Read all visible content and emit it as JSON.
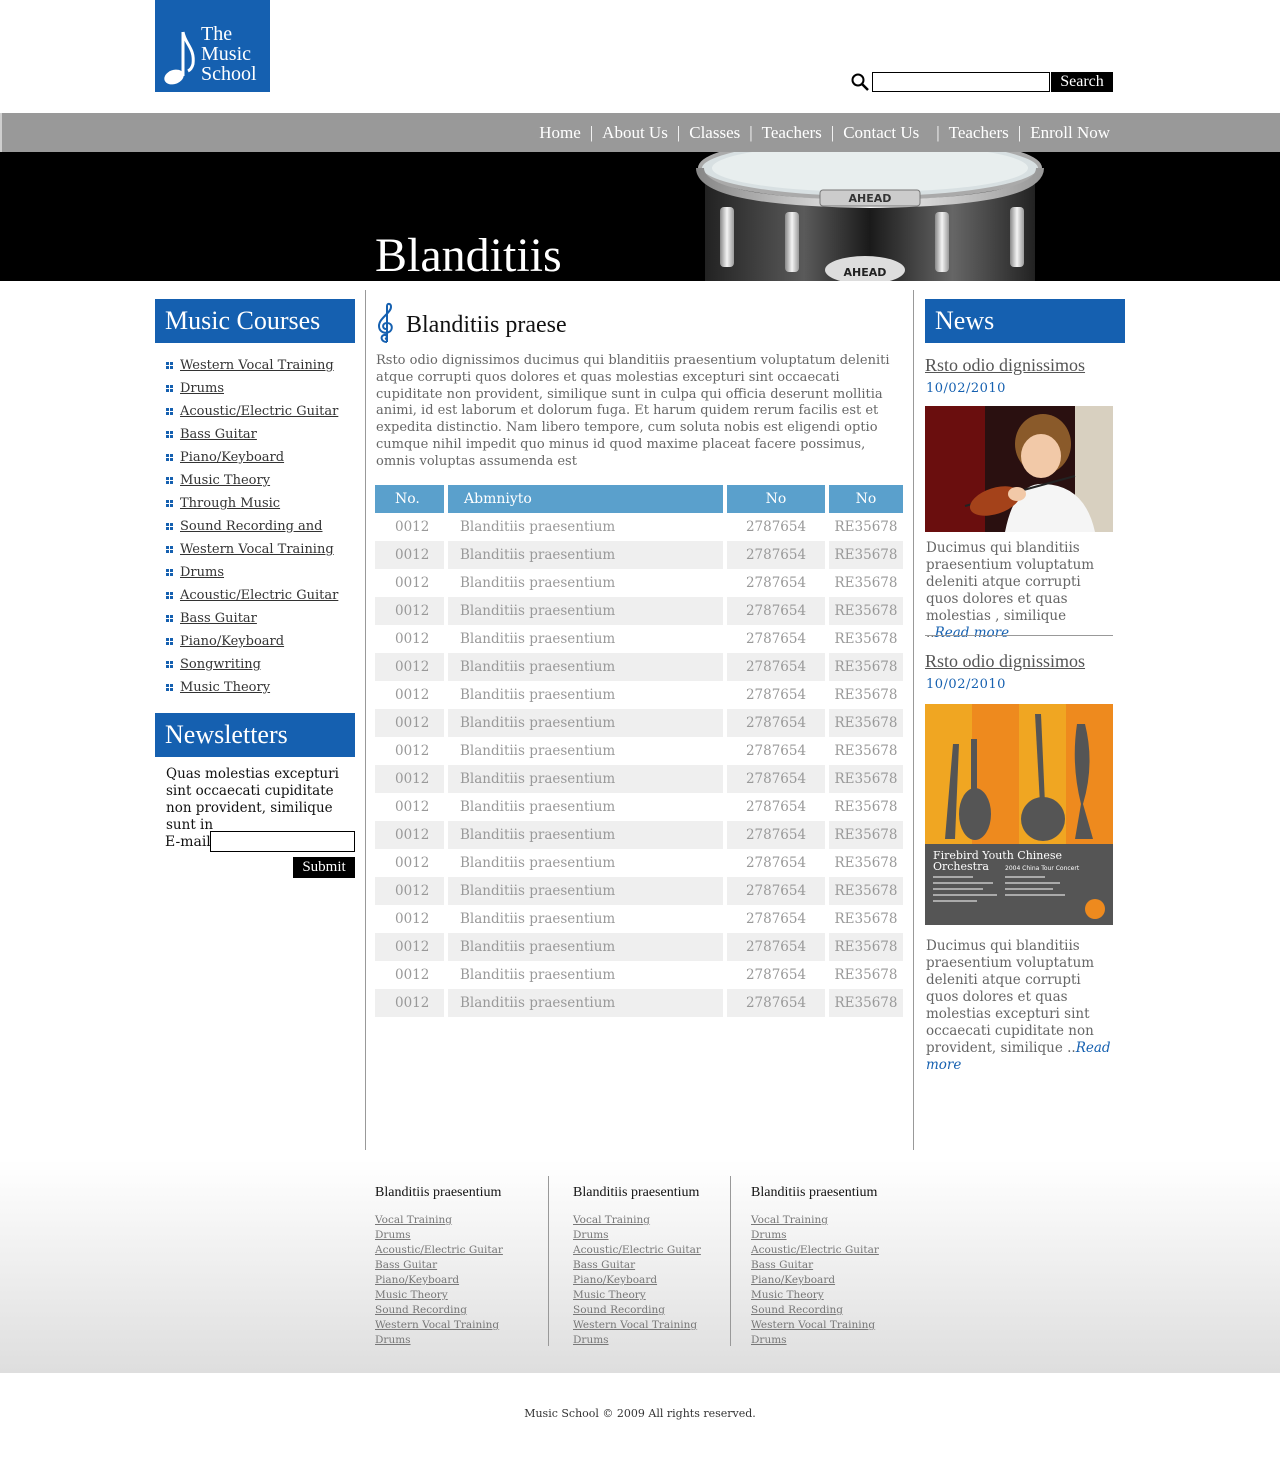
{
  "logo": {
    "line1": "The",
    "line2": "Music",
    "line3": "School"
  },
  "search": {
    "button_label": "Search",
    "value": ""
  },
  "nav": {
    "items": [
      "Home",
      "About Us",
      "Classes",
      "Teachers",
      "Contact Us",
      "Teachers",
      "Enroll Now"
    ]
  },
  "banner": {
    "title": "Blanditiis"
  },
  "sidebar": {
    "courses_title": "Music Courses",
    "courses": [
      "Western Vocal Training",
      "Drums",
      "Acoustic/Electric Guitar",
      "Bass Guitar",
      "Piano/Keyboard",
      "Music Theory",
      "Through Music",
      "Sound Recording and",
      "Western Vocal Training",
      "Drums",
      "Acoustic/Electric Guitar",
      "Bass Guitar",
      "Piano/Keyboard",
      "Songwriting",
      "Music Theory"
    ],
    "newsletter_title": "Newsletters",
    "newsletter_text": "Quas molestias excepturi sint occaecati cupiditate non provident, similique sunt in",
    "email_label": "E-mail",
    "submit_label": "Submit"
  },
  "main": {
    "title": "Blanditiis praese",
    "paragraph": "Rsto odio dignissimos ducimus qui blanditiis praesentium voluptatum deleniti atque corrupti quos dolores et quas molestias excepturi sint occaecati cupiditate non provident, similique sunt in culpa qui officia deserunt mollitia animi, id est laborum et dolorum fuga. Et harum quidem rerum facilis est et expedita distinctio. Nam libero tempore, cum soluta nobis est eligendi optio cumque nihil impedit quo minus id quod maxime placeat facere possimus, omnis voluptas assumenda est",
    "table": {
      "headers": [
        "No.",
        "Abmniyto",
        "No",
        "No"
      ],
      "rows": [
        [
          "0012",
          "Blanditiis praesentium",
          "2787654",
          "RE35678"
        ],
        [
          "0012",
          "Blanditiis praesentium",
          "2787654",
          "RE35678"
        ],
        [
          "0012",
          "Blanditiis praesentium",
          "2787654",
          "RE35678"
        ],
        [
          "0012",
          "Blanditiis praesentium",
          "2787654",
          "RE35678"
        ],
        [
          "0012",
          "Blanditiis praesentium",
          "2787654",
          "RE35678"
        ],
        [
          "0012",
          "Blanditiis praesentium",
          "2787654",
          "RE35678"
        ],
        [
          "0012",
          "Blanditiis praesentium",
          "2787654",
          "RE35678"
        ],
        [
          "0012",
          "Blanditiis praesentium",
          "2787654",
          "RE35678"
        ],
        [
          "0012",
          "Blanditiis praesentium",
          "2787654",
          "RE35678"
        ],
        [
          "0012",
          "Blanditiis praesentium",
          "2787654",
          "RE35678"
        ],
        [
          "0012",
          "Blanditiis praesentium",
          "2787654",
          "RE35678"
        ],
        [
          "0012",
          "Blanditiis praesentium",
          "2787654",
          "RE35678"
        ],
        [
          "0012",
          "Blanditiis praesentium",
          "2787654",
          "RE35678"
        ],
        [
          "0012",
          "Blanditiis praesentium",
          "2787654",
          "RE35678"
        ],
        [
          "0012",
          "Blanditiis praesentium",
          "2787654",
          "RE35678"
        ],
        [
          "0012",
          "Blanditiis praesentium",
          "2787654",
          "RE35678"
        ],
        [
          "0012",
          "Blanditiis praesentium",
          "2787654",
          "RE35678"
        ],
        [
          "0012",
          "Blanditiis praesentium",
          "2787654",
          "RE35678"
        ]
      ]
    }
  },
  "news": {
    "title": "News",
    "items": [
      {
        "title": "Rsto odio dignissimos",
        "date": "10/02/2010",
        "text": "Ducimus qui blanditiis praesentium voluptatum deleniti atque corrupti quos dolores et quas molestias , similique ..",
        "read_more": "Read more"
      },
      {
        "title": "Rsto odio dignissimos",
        "date": "10/02/2010",
        "text": "Ducimus qui blanditiis praesentium voluptatum deleniti atque corrupti quos dolores et quas molestias excepturi sint occaecati cupiditate non provident, similique ..",
        "read_more": "Read more"
      }
    ],
    "poster": {
      "line1": "Firebird Youth Chinese",
      "line2": "Orchestra",
      "subtitle": "2004 China Tour Concert"
    }
  },
  "footer": {
    "columns": [
      {
        "title": "Blanditiis praesentium",
        "links": [
          "Vocal Training",
          "Drums",
          "Acoustic/Electric Guitar",
          "Bass Guitar",
          "Piano/Keyboard",
          "Music Theory",
          "Sound Recording",
          "Western Vocal Training",
          "Drums"
        ]
      },
      {
        "title": "Blanditiis praesentium",
        "links": [
          "Vocal Training",
          "Drums",
          "Acoustic/Electric Guitar",
          "Bass Guitar",
          "Piano/Keyboard",
          "Music Theory",
          "Sound Recording",
          "Western Vocal Training",
          "Drums"
        ]
      },
      {
        "title": "Blanditiis praesentium",
        "links": [
          "Vocal Training",
          "Drums",
          "Acoustic/Electric Guitar",
          "Bass Guitar",
          "Piano/Keyboard",
          "Music Theory",
          "Sound Recording",
          "Western Vocal Training",
          "Drums"
        ]
      }
    ],
    "copyright": "Music School © 2009 All rights reserved."
  },
  "colors": {
    "brand_blue": "#1560b0",
    "table_header": "#5aa0cc",
    "nav_bar": "#999999",
    "banner": "#000000"
  }
}
